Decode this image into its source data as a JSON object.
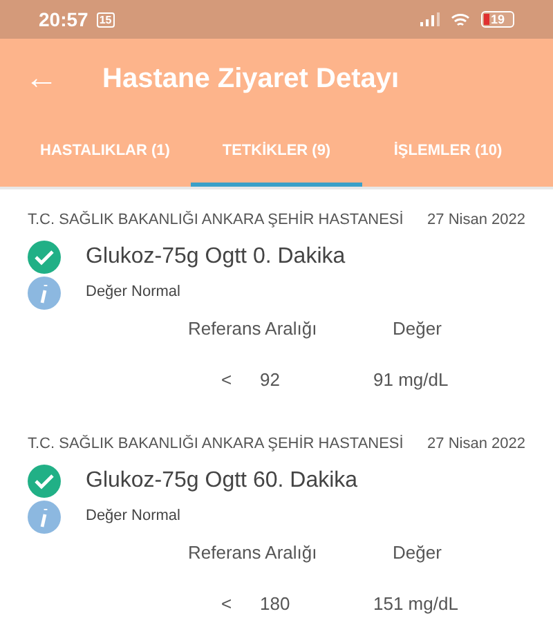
{
  "status_bar": {
    "time": "20:57",
    "notification_badge": "15",
    "battery": "19"
  },
  "header": {
    "back": "←",
    "title": "Hastane Ziyaret Detayı"
  },
  "tabs": [
    {
      "label": "HASTALIKLAR (1)",
      "selected": false
    },
    {
      "label": "TETKİKLER (9)",
      "selected": true
    },
    {
      "label": "İŞLEMLER (10)",
      "selected": false
    }
  ],
  "tests": [
    {
      "hospital": "T.C. SAĞLIK BAKANLIĞI ANKARA ŞEHİR HASTANESİ",
      "date": "27 Nisan 2022",
      "name": "Glukoz-75g Ogtt 0. Dakika",
      "status": "Değer Normal",
      "normal": true,
      "range_header": "Referans Aralığı",
      "value_header": "Değer",
      "operator": "<",
      "range": "92",
      "value": "91 mg/dL"
    },
    {
      "hospital": "T.C. SAĞLIK BAKANLIĞI ANKARA ŞEHİR HASTANESİ",
      "date": "27 Nisan 2022",
      "name": "Glukoz-75g Ogtt 60. Dakika",
      "status": "Değer Normal",
      "normal": true,
      "range_header": "Referans Aralığı",
      "value_header": "Değer",
      "operator": "<",
      "range": "180",
      "value": "151 mg/dL"
    }
  ]
}
